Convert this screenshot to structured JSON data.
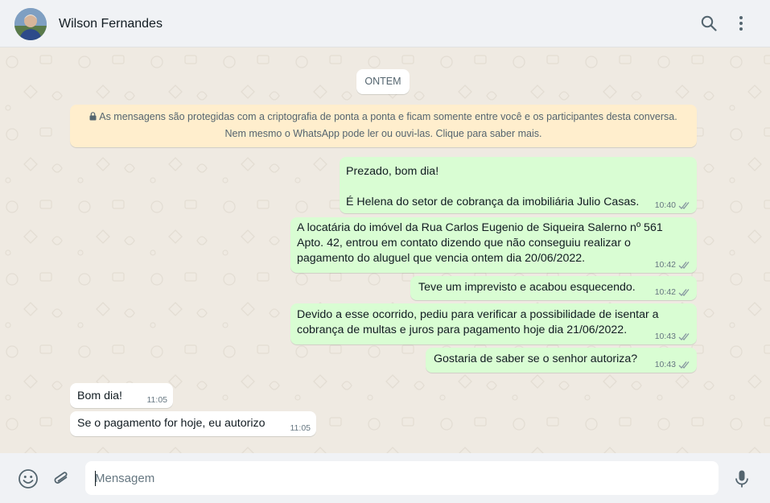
{
  "header": {
    "contact_name": "Wilson Fernandes"
  },
  "chat": {
    "date_divider": "ONTEM",
    "encryption_notice": {
      "line1": "As mensagens são protegidas com a criptografia de ponta a ponta e ficam somente entre você e os participantes desta conversa.",
      "line2": "Nem mesmo o WhatsApp pode ler ou ouvi-las. Clique para saber mais."
    },
    "messages": [
      {
        "direction": "out",
        "text": "Prezado, bom dia!\n\nÉ Helena do setor de cobrança da imobiliária Julio Casas.",
        "time": "10:40"
      },
      {
        "direction": "out",
        "text": "A locatária do imóvel da Rua Carlos Eugenio de Siqueira Salerno nº 561 Apto. 42, entrou em contato dizendo que não conseguiu realizar o pagamento do aluguel que vencia ontem dia 20/06/2022.",
        "time": "10:42"
      },
      {
        "direction": "out",
        "text": "Teve um imprevisto e acabou esquecendo.",
        "time": "10:42"
      },
      {
        "direction": "out",
        "text": "Devido a esse ocorrido, pediu para verificar a possibilidade de isentar a cobrança de multas e juros para pagamento hoje dia 21/06/2022.",
        "time": "10:43"
      },
      {
        "direction": "out",
        "text": "Gostaria de saber se o senhor autoriza?",
        "time": "10:43"
      },
      {
        "direction": "in",
        "text": "Bom dia!",
        "time": "11:05"
      },
      {
        "direction": "in",
        "text": "Se o pagamento for hoje, eu autorizo",
        "time": "11:05"
      }
    ]
  },
  "footer": {
    "message_placeholder": "Mensagem"
  },
  "colors": {
    "outgoing_bubble": "#d9fdd3",
    "incoming_bubble": "#ffffff",
    "notice_bg": "#ffeecd",
    "read_ticks": "#8696a0"
  },
  "icons": [
    "search-icon",
    "menu-icon",
    "emoji-icon",
    "attach-icon",
    "microphone-icon",
    "lock-icon",
    "double-check-icon"
  ]
}
